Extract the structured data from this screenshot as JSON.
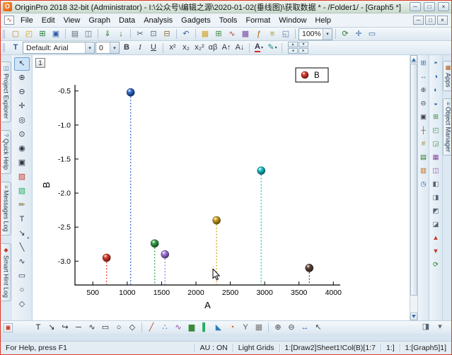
{
  "ui": {
    "chevron": "▾"
  },
  "window": {
    "title": "OriginPro 2018 32-bit (Administrator) - I:\\公众号\\编辑之源\\2020-01-02(垂线图)\\获取数据 * - /Folder1/ - [Graph5 *]",
    "app_icon_glyph": "O",
    "buttons": {
      "minimize": "─",
      "restore": "□",
      "close": "×"
    }
  },
  "menu": {
    "child_icon_glyph": "∿",
    "items": [
      "File",
      "Edit",
      "View",
      "Graph",
      "Data",
      "Analysis",
      "Gadgets",
      "Tools",
      "Format",
      "Window",
      "Help"
    ],
    "mdi_buttons": {
      "minimize": "─",
      "restore": "□",
      "close": "×"
    }
  },
  "toolbar_standard": {
    "zoom_value": "100%",
    "items": [
      {
        "name": "new-project",
        "glyph": "▢",
        "color": "#c8881e"
      },
      {
        "name": "open",
        "glyph": "◰",
        "color": "#d8a018"
      },
      {
        "name": "open-excel",
        "glyph": "⊞",
        "color": "#1e7a34"
      },
      {
        "name": "save-project",
        "glyph": "▣",
        "color": "#2e5fa3"
      },
      {
        "sep": true
      },
      {
        "name": "print",
        "glyph": "▤",
        "color": "#5a6a7a"
      },
      {
        "name": "print-preview",
        "glyph": "◫",
        "color": "#5a6a7a"
      },
      {
        "sep": true
      },
      {
        "name": "import-wizard",
        "glyph": "⇓",
        "color": "#2a7d2a"
      },
      {
        "name": "import-ascii",
        "glyph": "↓",
        "color": "#2a7d2a"
      },
      {
        "sep": true
      },
      {
        "name": "cut",
        "glyph": "✂",
        "color": "#445566"
      },
      {
        "name": "copy",
        "glyph": "⊡",
        "color": "#446688"
      },
      {
        "name": "paste",
        "glyph": "⊟",
        "color": "#8a6d3b"
      },
      {
        "sep": true
      },
      {
        "name": "undo",
        "glyph": "↶",
        "color": "#2a5fa5"
      },
      {
        "sep": true
      },
      {
        "name": "new-folder",
        "glyph": "▦",
        "color": "#d8a018"
      },
      {
        "name": "new-workbook",
        "glyph": "⊞",
        "color": "#3a8a3a"
      },
      {
        "name": "new-graph",
        "glyph": "∿",
        "color": "#c0392b"
      },
      {
        "name": "new-matrix",
        "glyph": "▩",
        "color": "#7a4aa5"
      },
      {
        "name": "new-function",
        "glyph": "ƒ",
        "color": "#b05a00"
      },
      {
        "name": "new-notes",
        "glyph": "≡",
        "color": "#99992a"
      },
      {
        "name": "new-layout",
        "glyph": "◱",
        "color": "#5a7a9a"
      },
      {
        "sep": true
      },
      {
        "combo": "zoom"
      },
      {
        "sep": true
      },
      {
        "name": "refresh",
        "glyph": "⟳",
        "color": "#2a7d2a"
      },
      {
        "name": "rescale",
        "glyph": "✛",
        "color": "#3a6ea5"
      },
      {
        "name": "fit-page",
        "glyph": "▭",
        "color": "#3a6ea5"
      }
    ]
  },
  "toolbar_format": {
    "apply_glyph": "T",
    "style_value": "Default: Arial",
    "size_value": "0",
    "items": [
      {
        "name": "bold",
        "glyph": "B",
        "cls": "bold"
      },
      {
        "name": "italic",
        "glyph": "I",
        "cls": "italic"
      },
      {
        "name": "underline",
        "glyph": "U",
        "cls": "underline"
      },
      {
        "sep": true
      },
      {
        "name": "superscript",
        "glyph": "x²"
      },
      {
        "name": "subscript",
        "glyph": "x₂"
      },
      {
        "name": "super-subscript",
        "glyph": "x₂²"
      },
      {
        "name": "greek",
        "glyph": "αβ"
      },
      {
        "name": "increase-font",
        "glyph": "A↑"
      },
      {
        "name": "decrease-font",
        "glyph": "A↓"
      },
      {
        "sep": true
      },
      {
        "name": "font-color",
        "glyph": "A",
        "cls": "fontcolor",
        "dropdown": true
      },
      {
        "name": "line-color",
        "glyph": "✎",
        "color": "#178a8a",
        "dropdown": true
      },
      {
        "sep": true
      }
    ],
    "mini_buttons": [
      "▴",
      "▾",
      "◂",
      "▸"
    ]
  },
  "left_panel_tabs": [
    {
      "label": "Project Explorer",
      "icon_glyph": "◫",
      "icon_color": "#2a5fa5"
    },
    {
      "label": "Quick Help",
      "icon_glyph": "?",
      "icon_color": "#2a5fa5"
    },
    {
      "label": "Messages Log",
      "icon_glyph": "≡",
      "icon_color": "#8a6d3b"
    },
    {
      "label": "Smart Hint Log",
      "icon_glyph": "◆",
      "icon_color": "#c0392b"
    }
  ],
  "right_panel_tabs": [
    {
      "label": "Apps",
      "icon_glyph": "▦",
      "icon_color": "#b3591e"
    },
    {
      "label": "Object Manager",
      "icon_glyph": "≡",
      "icon_color": "#2a5fa5"
    }
  ],
  "left_tools": {
    "items": [
      {
        "name": "pointer-tool",
        "glyph": "↖",
        "active": true
      },
      {
        "name": "scale-in-tool",
        "glyph": "⊕"
      },
      {
        "name": "scale-out-tool",
        "glyph": "⊖"
      },
      {
        "name": "pan-tool",
        "glyph": "✛"
      },
      {
        "name": "screen-reader-tool",
        "glyph": "◎"
      },
      {
        "name": "data-reader-tool",
        "glyph": "⊙"
      },
      {
        "name": "data-selector-tool",
        "glyph": "◉"
      },
      {
        "name": "select-all-plots-tool",
        "glyph": "▣"
      },
      {
        "name": "mask-tool",
        "glyph": "▨",
        "color": "#c0392b"
      },
      {
        "name": "unmask-tool",
        "glyph": "▧",
        "color": "#27ae60"
      },
      {
        "name": "draw-data-tool",
        "glyph": "✏",
        "color": "#8a6d3b"
      },
      {
        "name": "text-tool",
        "glyph": "T"
      },
      {
        "name": "arrow-tool",
        "glyph": "↘",
        "dropdown": true
      },
      {
        "name": "line-tool",
        "glyph": "╲"
      },
      {
        "name": "polyline-tool",
        "glyph": "∿"
      },
      {
        "name": "rectangle-tool",
        "glyph": "▭"
      },
      {
        "name": "circle-tool",
        "glyph": "○"
      },
      {
        "name": "polygon-tool",
        "glyph": "◇"
      }
    ]
  },
  "right_toolbar_a": {
    "items": [
      {
        "name": "new-layer",
        "glyph": "⊞",
        "color": "#3a6ea5"
      },
      {
        "name": "rescale-axes",
        "glyph": "↔",
        "color": "#3a6ea5"
      },
      {
        "name": "zoom-in",
        "glyph": "⊕",
        "color": "#445"
      },
      {
        "name": "zoom-out",
        "glyph": "⊖",
        "color": "#445"
      },
      {
        "name": "whole-page",
        "glyph": "▣",
        "color": "#445"
      },
      {
        "name": "axes-dialog",
        "glyph": "┼",
        "color": "#8a4a2a"
      },
      {
        "name": "grid-toggle",
        "glyph": "#",
        "color": "#8a8a2a"
      },
      {
        "name": "add-legend",
        "glyph": "▤",
        "color": "#2a7d2a"
      },
      {
        "name": "add-color-scale",
        "glyph": "▥",
        "color": "#c06a1a"
      },
      {
        "name": "add-datetime",
        "glyph": "◷",
        "color": "#2a5fa5"
      }
    ]
  },
  "right_toolbar_b": {
    "items": [
      {
        "name": "add-top-axis",
        "glyph": "◓",
        "color": "#2a5fa5"
      },
      {
        "name": "add-right-axis",
        "glyph": "◑",
        "color": "#2a5fa5"
      },
      {
        "name": "add-left-axis",
        "glyph": "◐",
        "color": "#2a5fa5"
      },
      {
        "name": "add-bottom-axis",
        "glyph": "◒",
        "color": "#2a5fa5"
      },
      {
        "name": "add-layer",
        "glyph": "⊞",
        "color": "#3a8a3a"
      },
      {
        "name": "add-inset",
        "glyph": "◰",
        "color": "#3a8a3a"
      },
      {
        "name": "add-inset-data",
        "glyph": "◲",
        "color": "#3a8a3a"
      },
      {
        "name": "merge-layers",
        "glyph": "▦",
        "color": "#8a4aa5"
      },
      {
        "name": "extract-layers",
        "glyph": "◫",
        "color": "#8a4aa5"
      },
      {
        "name": "align-left",
        "glyph": "◧",
        "color": "#556677"
      },
      {
        "name": "align-right",
        "glyph": "◨",
        "color": "#556677"
      },
      {
        "name": "align-top",
        "glyph": "◩",
        "color": "#556677"
      },
      {
        "name": "align-bottom",
        "glyph": "◪",
        "color": "#556677"
      },
      {
        "name": "bring-front",
        "glyph": "▲",
        "color": "#c0392b"
      },
      {
        "name": "send-back",
        "glyph": "▼",
        "color": "#c0392b"
      },
      {
        "name": "rotate-object",
        "glyph": "⟳",
        "color": "#2a7d2a"
      }
    ]
  },
  "bottom_toolbar": {
    "dock_glyph": "▣",
    "items": [
      {
        "name": "text-annotation",
        "glyph": "T",
        "color": "#222"
      },
      {
        "name": "arrow-annotation",
        "glyph": "↘",
        "color": "#222"
      },
      {
        "name": "curved-arrow",
        "glyph": "↪",
        "color": "#222"
      },
      {
        "name": "line-annotation",
        "glyph": "─",
        "color": "#222"
      },
      {
        "name": "polyline-annotation",
        "glyph": "∿",
        "color": "#222"
      },
      {
        "name": "rectangle-annotation",
        "glyph": "▭",
        "color": "#222"
      },
      {
        "name": "ellipse-annotation",
        "glyph": "○",
        "color": "#222"
      },
      {
        "name": "polygon-annotation",
        "glyph": "◇",
        "color": "#222"
      },
      {
        "sep": true
      },
      {
        "name": "line-plot",
        "glyph": "╱",
        "color": "#c0392b"
      },
      {
        "name": "scatter-plot",
        "glyph": "∴",
        "color": "#2e6bd0"
      },
      {
        "name": "line-symbol-plot",
        "glyph": "∿",
        "color": "#8e44ad"
      },
      {
        "name": "column-plot",
        "glyph": "▆",
        "color": "#3a8a3a"
      },
      {
        "name": "bar-plot",
        "glyph": "▌",
        "color": "#27ae60"
      },
      {
        "name": "area-plot",
        "glyph": "◣",
        "color": "#2980b9"
      },
      {
        "name": "pie-plot",
        "glyph": "◔",
        "color": "#d35400"
      },
      {
        "name": "double-y-plot",
        "glyph": "Y",
        "color": "#555"
      },
      {
        "name": "template-plot",
        "glyph": "▦",
        "color": "#777"
      },
      {
        "sep": true
      },
      {
        "name": "zoom-in-plot",
        "glyph": "⊕",
        "color": "#445"
      },
      {
        "name": "zoom-out-plot",
        "glyph": "⊖",
        "color": "#445"
      },
      {
        "name": "rescale-plot",
        "glyph": "↔",
        "color": "#3a6ea5"
      },
      {
        "name": "pointer-select",
        "glyph": "↖",
        "color": "#445"
      }
    ]
  },
  "bottom_right": {
    "items": [
      {
        "name": "toolbar-options",
        "glyph": "◨",
        "color": "#556677"
      },
      {
        "name": "more-tools",
        "glyph": "▾",
        "color": "#556677"
      }
    ]
  },
  "graph": {
    "layer_badge": "1"
  },
  "chart_data": {
    "type": "scatter",
    "subtype": "vertical-drop-lines",
    "title": "",
    "xlabel": "A",
    "ylabel": "B",
    "xlim": [
      240,
      4100
    ],
    "ylim": [
      -3.35,
      -0.41
    ],
    "xticks": [
      500,
      1000,
      1500,
      2000,
      2500,
      3000,
      3500,
      4000
    ],
    "yticks": [
      -0.5,
      -1.0,
      -1.5,
      -2.0,
      -2.5,
      -3.0
    ],
    "grid": false,
    "legend": {
      "position": "top-right",
      "entries": [
        {
          "label": "B",
          "color": "#e23b2e"
        }
      ]
    },
    "series": [
      {
        "name": "B",
        "points": [
          {
            "x": 700,
            "y": -2.95,
            "color": "#e23b2e"
          },
          {
            "x": 1050,
            "y": -0.52,
            "color": "#2f6bd0"
          },
          {
            "x": 1400,
            "y": -2.74,
            "color": "#37a74e"
          },
          {
            "x": 1550,
            "y": -2.9,
            "color": "#a97ae0"
          },
          {
            "x": 2300,
            "y": -2.4,
            "color": "#d3a41f"
          },
          {
            "x": 2950,
            "y": -1.67,
            "color": "#19c5cd"
          },
          {
            "x": 3650,
            "y": -3.1,
            "color": "#5e463c"
          }
        ]
      }
    ]
  },
  "status_bar": {
    "left": "For Help, press F1",
    "segments": [
      "AU : ON",
      "Light Grids",
      "1:[Draw2]Sheet1!Col(B)[1:7",
      "1:]",
      "1:[Graph5]1]"
    ]
  }
}
